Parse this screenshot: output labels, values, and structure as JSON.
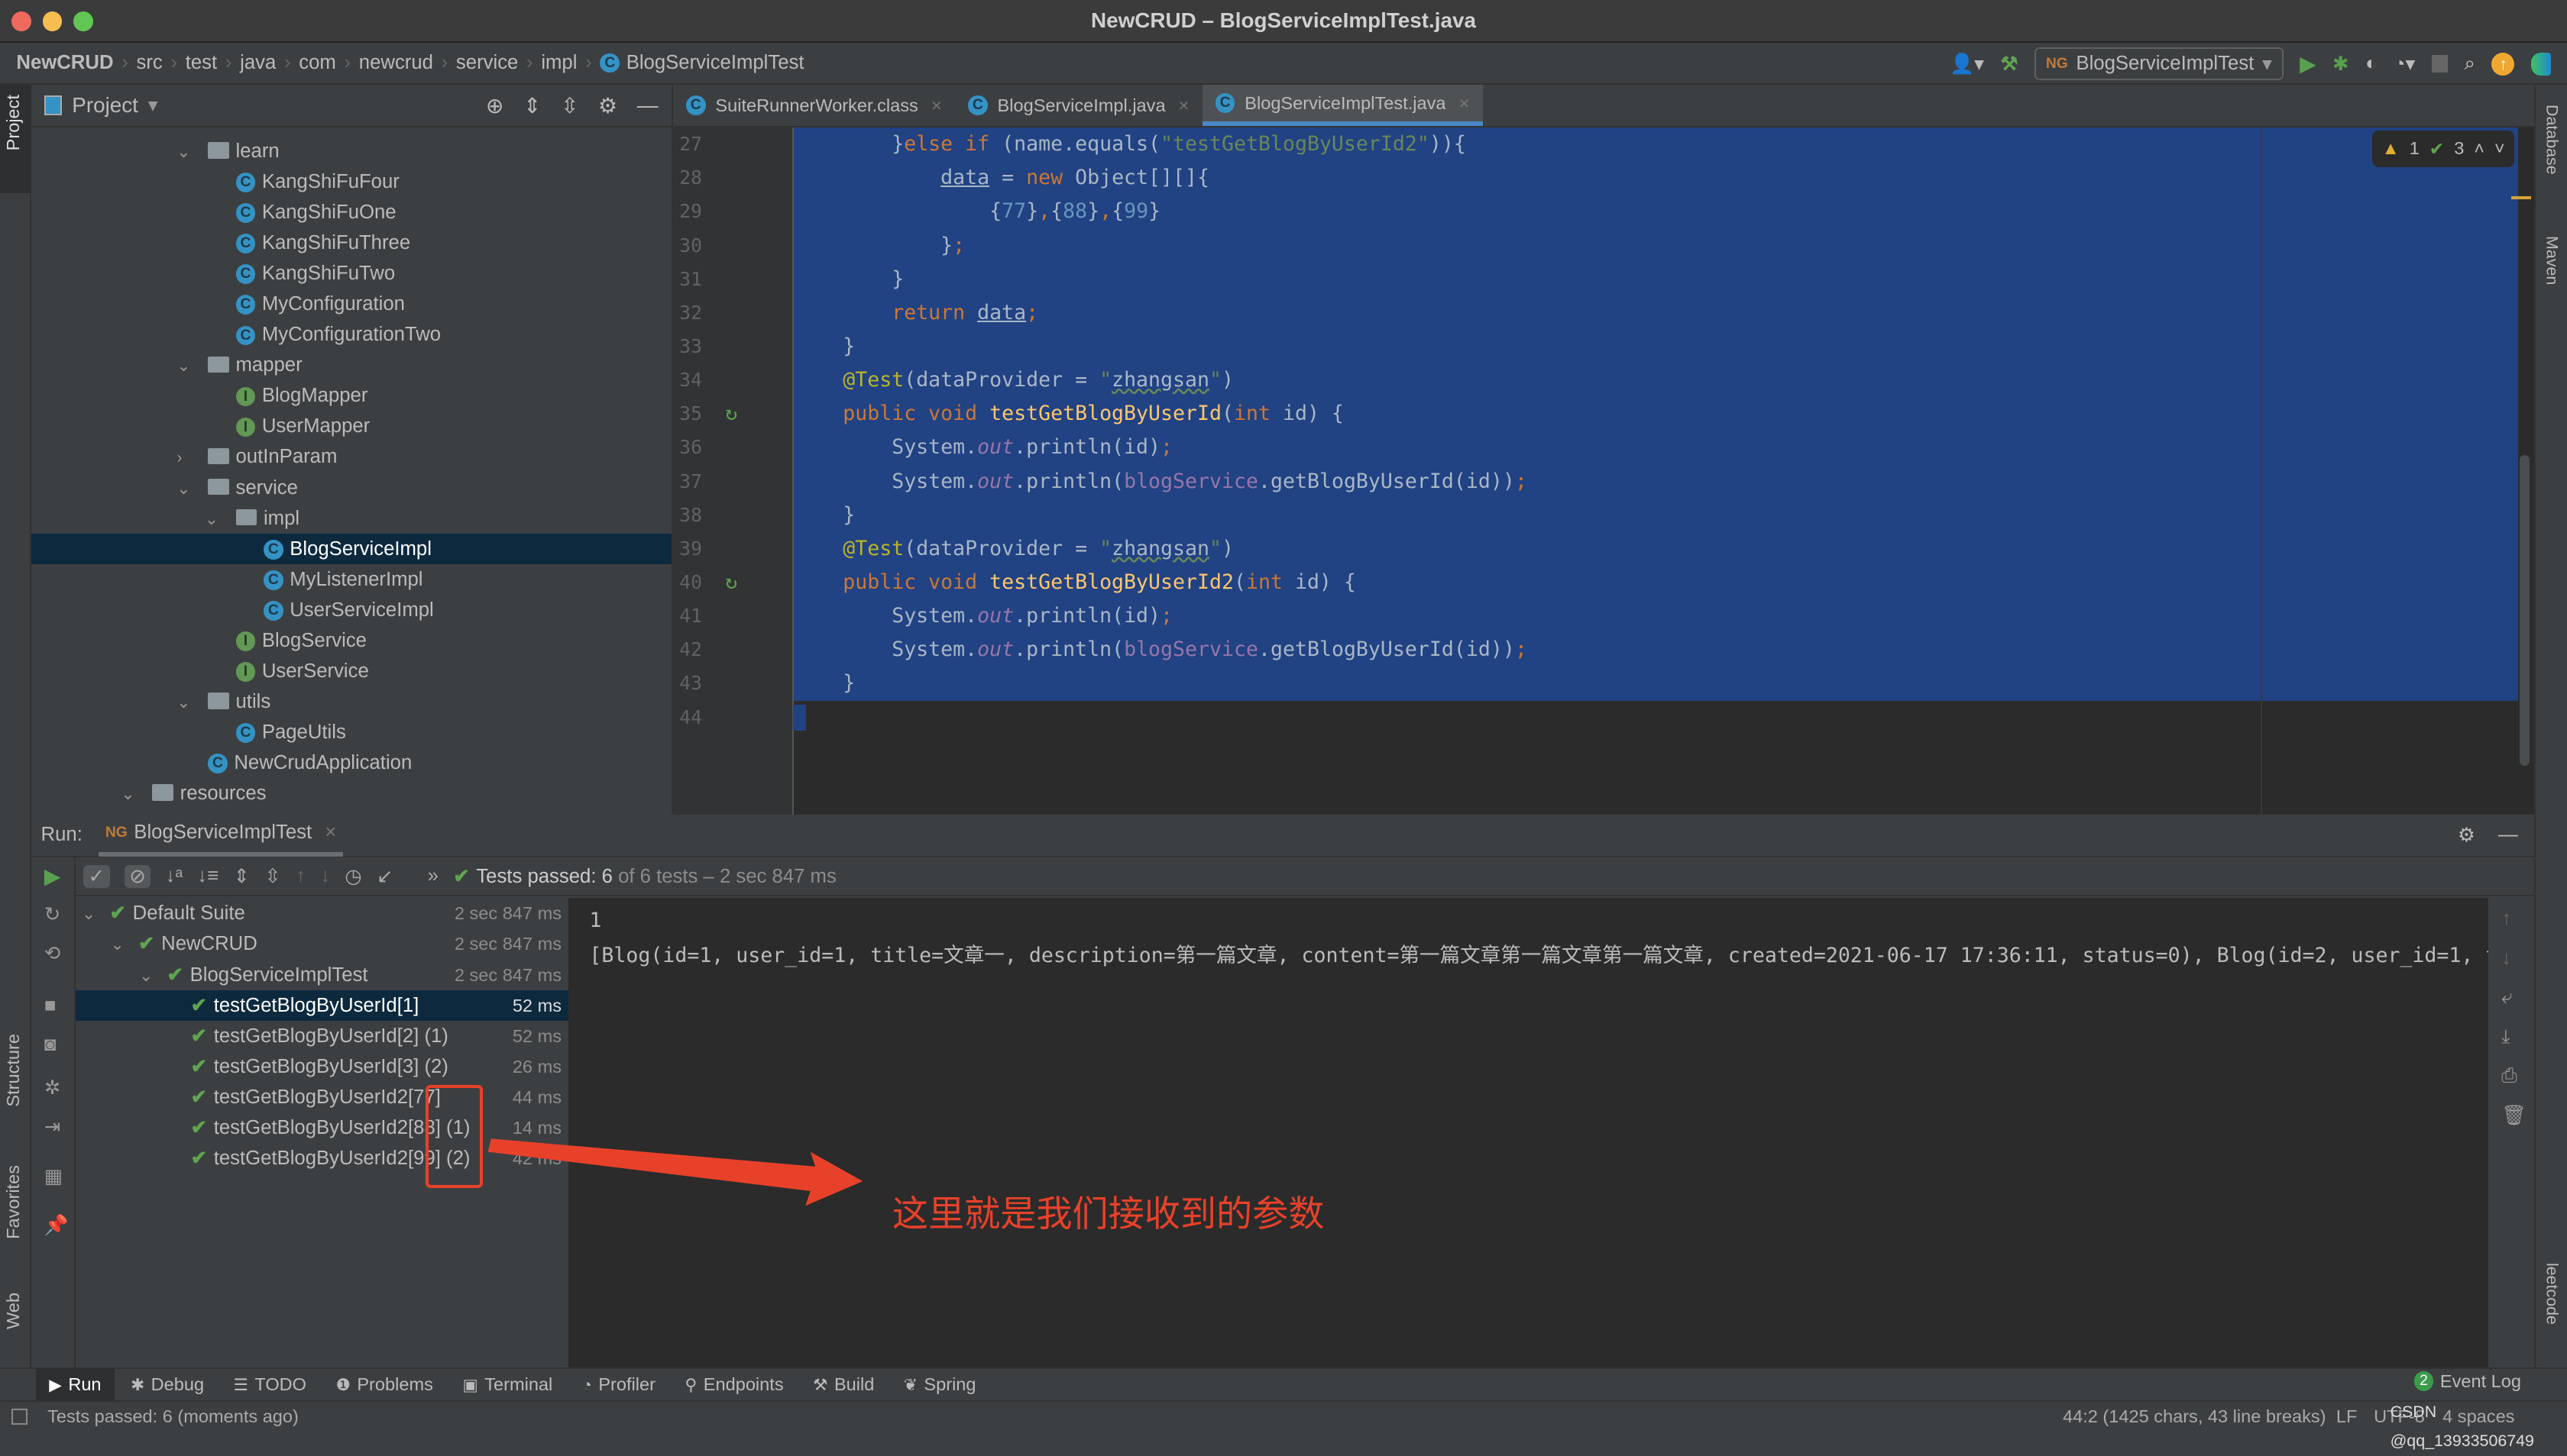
{
  "window": {
    "title": "NewCRUD – BlogServiceImplTest.java"
  },
  "nav": {
    "breadcrumbs": [
      "NewCRUD",
      "src",
      "test",
      "java",
      "com",
      "newcrud",
      "service",
      "impl",
      "BlogServiceImplTest"
    ],
    "run_config": "BlogServiceImplTest"
  },
  "side": {
    "left": [
      "Project",
      "Structure",
      "Favorites",
      "Web"
    ],
    "right": [
      "Database",
      "Maven",
      "leetcode"
    ]
  },
  "project": {
    "header": "Project",
    "tree": [
      {
        "label": "learn",
        "level": 2,
        "type": "folder",
        "arrow": "down"
      },
      {
        "label": "KangShiFuFour",
        "level": 3,
        "type": "class"
      },
      {
        "label": "KangShiFuOne",
        "level": 3,
        "type": "class"
      },
      {
        "label": "KangShiFuThree",
        "level": 3,
        "type": "class"
      },
      {
        "label": "KangShiFuTwo",
        "level": 3,
        "type": "class"
      },
      {
        "label": "MyConfiguration",
        "level": 3,
        "type": "class"
      },
      {
        "label": "MyConfigurationTwo",
        "level": 3,
        "type": "class"
      },
      {
        "label": "mapper",
        "level": 2,
        "type": "folder",
        "arrow": "down"
      },
      {
        "label": "BlogMapper",
        "level": 3,
        "type": "interface"
      },
      {
        "label": "UserMapper",
        "level": 3,
        "type": "interface"
      },
      {
        "label": "outInParam",
        "level": 2,
        "type": "folder",
        "arrow": "right"
      },
      {
        "label": "service",
        "level": 2,
        "type": "folder",
        "arrow": "down"
      },
      {
        "label": "impl",
        "level": 3,
        "type": "folder",
        "arrow": "down"
      },
      {
        "label": "BlogServiceImpl",
        "level": 4,
        "type": "class",
        "selected": true
      },
      {
        "label": "MyListenerImpl",
        "level": 4,
        "type": "class"
      },
      {
        "label": "UserServiceImpl",
        "level": 4,
        "type": "class"
      },
      {
        "label": "BlogService",
        "level": 3,
        "type": "interface"
      },
      {
        "label": "UserService",
        "level": 3,
        "type": "interface"
      },
      {
        "label": "utils",
        "level": 2,
        "type": "folder",
        "arrow": "down"
      },
      {
        "label": "PageUtils",
        "level": 3,
        "type": "class"
      },
      {
        "label": "NewCrudApplication",
        "level": 2,
        "type": "class"
      },
      {
        "label": "resources",
        "level": 0,
        "type": "folder",
        "arrow": "down"
      }
    ]
  },
  "editor": {
    "tabs": [
      {
        "label": "SuiteRunnerWorker.class",
        "active": false
      },
      {
        "label": "BlogServiceImpl.java",
        "active": false
      },
      {
        "label": "BlogServiceImplTest.java",
        "active": true
      }
    ],
    "inspection": {
      "warnings": "1",
      "ok": "3"
    },
    "lines": [
      {
        "num": "27",
        "sel": true,
        "tokens": [
          [
            "        }",
            ""
          ],
          [
            "else if ",
            "kw"
          ],
          [
            "(name.equals(",
            ""
          ],
          [
            "\"testGetBlogByUserId2\"",
            "str"
          ],
          [
            ")){",
            ""
          ]
        ]
      },
      {
        "num": "28",
        "sel": true,
        "tokens": [
          [
            "            ",
            ""
          ],
          [
            "data",
            "ul"
          ],
          [
            " = ",
            ""
          ],
          [
            "new ",
            "kw"
          ],
          [
            "Object[][]{",
            ""
          ]
        ]
      },
      {
        "num": "29",
        "sel": true,
        "tokens": [
          [
            "                {",
            ""
          ],
          [
            "77",
            "num"
          ],
          [
            "}",
            ""
          ],
          [
            ",",
            "kw"
          ],
          [
            "{",
            ""
          ],
          [
            "88",
            "num"
          ],
          [
            "}",
            ""
          ],
          [
            ",",
            "kw"
          ],
          [
            "{",
            ""
          ],
          [
            "99",
            "num"
          ],
          [
            "}",
            ""
          ]
        ]
      },
      {
        "num": "30",
        "sel": true,
        "tokens": [
          [
            "            }",
            ""
          ],
          [
            ";",
            "kw"
          ]
        ]
      },
      {
        "num": "31",
        "sel": true,
        "tokens": [
          [
            "        }",
            ""
          ]
        ]
      },
      {
        "num": "32",
        "sel": true,
        "tokens": [
          [
            "        ",
            ""
          ],
          [
            "return ",
            "kw"
          ],
          [
            "data",
            "ul"
          ],
          [
            ";",
            "kw"
          ]
        ]
      },
      {
        "num": "33",
        "sel": true,
        "tokens": [
          [
            "    }",
            ""
          ]
        ]
      },
      {
        "num": "34",
        "sel": true,
        "tokens": [
          [
            "    ",
            ""
          ],
          [
            "@Test",
            "ann"
          ],
          [
            "(dataProvider = ",
            ""
          ],
          [
            "\"",
            "str"
          ],
          [
            "zhangsan",
            "sq"
          ],
          [
            "\"",
            "str"
          ],
          [
            ")",
            ""
          ]
        ]
      },
      {
        "num": "35",
        "sel": true,
        "run": true,
        "tokens": [
          [
            "    ",
            ""
          ],
          [
            "public void ",
            "kw"
          ],
          [
            "testGetBlogByUserId",
            "fn"
          ],
          [
            "(",
            ""
          ],
          [
            "int ",
            "kw"
          ],
          [
            "id) {",
            ""
          ]
        ]
      },
      {
        "num": "36",
        "sel": true,
        "tokens": [
          [
            "        System.",
            ""
          ],
          [
            "out",
            "st"
          ],
          [
            ".println(id)",
            ""
          ],
          [
            ";",
            "kw"
          ]
        ]
      },
      {
        "num": "37",
        "sel": true,
        "tokens": [
          [
            "        System.",
            ""
          ],
          [
            "out",
            "st"
          ],
          [
            ".println(",
            ""
          ],
          [
            "blogService",
            "fld"
          ],
          [
            ".getBlogByUserId(id))",
            ""
          ],
          [
            ";",
            "kw"
          ]
        ]
      },
      {
        "num": "38",
        "sel": true,
        "tokens": [
          [
            "    }",
            ""
          ]
        ]
      },
      {
        "num": "39",
        "sel": true,
        "tokens": [
          [
            "    ",
            ""
          ],
          [
            "@Test",
            "ann"
          ],
          [
            "(dataProvider = ",
            ""
          ],
          [
            "\"",
            "str"
          ],
          [
            "zhangsan",
            "sq"
          ],
          [
            "\"",
            "str"
          ],
          [
            ")",
            ""
          ]
        ]
      },
      {
        "num": "40",
        "sel": true,
        "run": true,
        "tokens": [
          [
            "    ",
            ""
          ],
          [
            "public void ",
            "kw"
          ],
          [
            "testGetBlogByUserId2",
            "fn"
          ],
          [
            "(",
            ""
          ],
          [
            "int ",
            "kw"
          ],
          [
            "id) {",
            ""
          ]
        ]
      },
      {
        "num": "41",
        "sel": true,
        "tokens": [
          [
            "        System.",
            ""
          ],
          [
            "out",
            "st"
          ],
          [
            ".println(id)",
            ""
          ],
          [
            ";",
            "kw"
          ]
        ]
      },
      {
        "num": "42",
        "sel": true,
        "tokens": [
          [
            "        System.",
            ""
          ],
          [
            "out",
            "st"
          ],
          [
            ".println(",
            ""
          ],
          [
            "blogService",
            "fld"
          ],
          [
            ".getBlogByUserId(id))",
            ""
          ],
          [
            ";",
            "kw"
          ]
        ]
      },
      {
        "num": "43",
        "sel": true,
        "bulb": true,
        "tokens": [
          [
            "    }",
            ""
          ]
        ]
      },
      {
        "num": "44",
        "sel": false,
        "tokens": [
          [
            "}",
            ""
          ]
        ]
      }
    ]
  },
  "run": {
    "label": "Run:",
    "tab": "BlogServiceImplTest",
    "status_prefix": "Tests passed:",
    "status_count": "6",
    "status_rest": "of 6 tests – 2 sec 847 ms",
    "tree": [
      {
        "label": "Default Suite",
        "time": "2 sec 847 ms",
        "level": 0,
        "arrow": true
      },
      {
        "label": "NewCRUD",
        "time": "2 sec 847 ms",
        "level": 1,
        "arrow": true
      },
      {
        "label": "BlogServiceImplTest",
        "time": "2 sec 847 ms",
        "level": 2,
        "arrow": true
      },
      {
        "label": "testGetBlogByUserId[1]",
        "time": "52 ms",
        "level": 3,
        "selected": true
      },
      {
        "label": "testGetBlogByUserId[2] (1)",
        "time": "52 ms",
        "level": 3
      },
      {
        "label": "testGetBlogByUserId[3] (2)",
        "time": "26 ms",
        "level": 3
      },
      {
        "label": "testGetBlogByUserId2[77]",
        "time": "44 ms",
        "level": 3
      },
      {
        "label": "testGetBlogByUserId2[88] (1)",
        "time": "14 ms",
        "level": 3
      },
      {
        "label": "testGetBlogByUserId2[99] (2)",
        "time": "42 ms",
        "level": 3
      }
    ],
    "console": [
      "1",
      "[Blog(id=1, user_id=1, title=文章一, description=第一篇文章, content=第一篇文章第一篇文章第一篇文章, created=2021-06-17 17:36:11, status=0), Blog(id=2, user_id=1, t"
    ]
  },
  "annotation": {
    "text": "这里就是我们接收到的参数",
    "color": "#e8412a"
  },
  "bottom_tools": [
    {
      "label": "Run",
      "icon": "play-icon",
      "active": true
    },
    {
      "label": "Debug",
      "icon": "bug-icon"
    },
    {
      "label": "TODO",
      "icon": "list-icon"
    },
    {
      "label": "Problems",
      "icon": "problems-icon"
    },
    {
      "label": "Terminal",
      "icon": "terminal-icon"
    },
    {
      "label": "Profiler",
      "icon": "profiler-icon"
    },
    {
      "label": "Endpoints",
      "icon": "endpoints-icon"
    },
    {
      "label": "Build",
      "icon": "hammer-icon"
    },
    {
      "label": "Spring",
      "icon": "spring-icon"
    }
  ],
  "event_log": {
    "count": "2",
    "label": "Event Log"
  },
  "status": {
    "message": "Tests passed: 6 (moments ago)",
    "position": "44:2 (1425 chars, 43 line breaks)",
    "line_sep": "LF",
    "encoding": "UTF-8",
    "indent": "4 spaces",
    "watermark": "CSDN @qq_13933506749"
  },
  "colors": {
    "selection": "#214283",
    "editor_bg": "#2b2b2b",
    "pass": "#5fa550",
    "annotation": "#e8412a"
  }
}
